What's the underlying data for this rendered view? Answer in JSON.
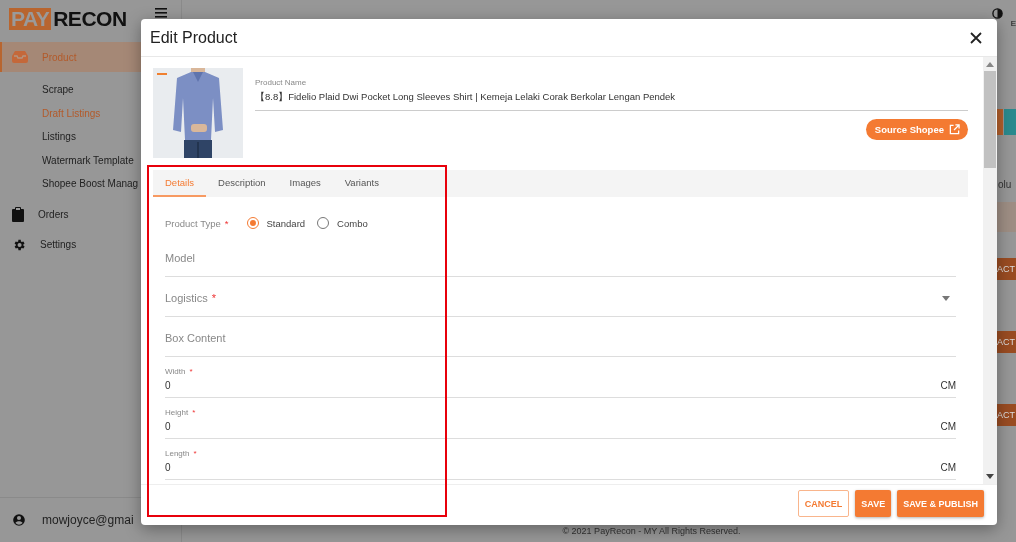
{
  "sidebar": {
    "logo": {
      "part_1": "PAY",
      "part_2": "RECON"
    },
    "items": [
      {
        "label": "Product",
        "selected": true,
        "children": [
          {
            "label": "Scrape",
            "selected": false
          },
          {
            "label": "Draft Listings",
            "selected": true
          },
          {
            "label": "Listings",
            "selected": false
          },
          {
            "label": "Watermark Template",
            "selected": false
          },
          {
            "label": "Shopee Boost Manag",
            "selected": false
          }
        ]
      },
      {
        "label": "Orders",
        "selected": false
      },
      {
        "label": "Settings",
        "selected": false
      }
    ],
    "user": "mowjoyce@gmai"
  },
  "topbar": {
    "language": "E"
  },
  "background": {
    "column_heading": "olu",
    "action_buttons": [
      "ACT",
      "ACT",
      "ACT"
    ]
  },
  "footer": "© 2021 PayRecon - MY All Rights Reserved.",
  "dialog": {
    "title": "Edit Product",
    "product_name_label": "Product Name",
    "product_name": "【8.8】Fidelio Plaid Dwi Pocket Long Sleeves Shirt | Kemeja Lelaki Corak Berkolar Lengan Pendek",
    "source_button": "Source Shopee",
    "tabs": [
      {
        "label": "Details",
        "selected": true
      },
      {
        "label": "Description",
        "selected": false
      },
      {
        "label": "Images",
        "selected": false
      },
      {
        "label": "Variants",
        "selected": false
      }
    ],
    "product_type": {
      "label": "Product Type",
      "required_mark": "*",
      "options": [
        {
          "label": "Standard",
          "selected": true
        },
        {
          "label": "Combo",
          "selected": false
        }
      ]
    },
    "fields": [
      {
        "kind": "text",
        "label": "Model"
      },
      {
        "kind": "select",
        "label": "Logistics",
        "required_mark": "*"
      },
      {
        "kind": "text",
        "label": "Box Content"
      },
      {
        "kind": "number",
        "label": "Width",
        "required_mark": "*",
        "value": "0",
        "unit": "CM"
      },
      {
        "kind": "number",
        "label": "Height",
        "required_mark": "*",
        "value": "0",
        "unit": "CM"
      },
      {
        "kind": "number",
        "label": "Length",
        "required_mark": "*",
        "value": "0",
        "unit": "CM"
      }
    ],
    "buttons": [
      {
        "label": "CANCEL",
        "kind": "outlined"
      },
      {
        "label": "SAVE",
        "kind": "filled"
      },
      {
        "label": "SAVE & PUBLISH",
        "kind": "filled"
      }
    ]
  }
}
